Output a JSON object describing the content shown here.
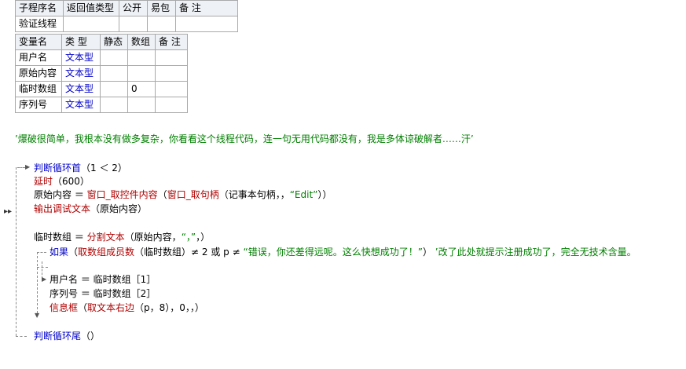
{
  "sub_table": {
    "headers": [
      "子程序名",
      "返回值类型",
      "公开",
      "易包",
      "备 注"
    ],
    "row": [
      "验证线程",
      "",
      "",
      "",
      ""
    ]
  },
  "var_table": {
    "headers": [
      "变量名",
      "类 型",
      "静态",
      "数组",
      "备 注"
    ],
    "rows": [
      [
        "用户名",
        "文本型",
        "",
        "",
        ""
      ],
      [
        "原始内容",
        "文本型",
        "",
        "",
        ""
      ],
      [
        "临时数组",
        "文本型",
        "",
        "0",
        ""
      ],
      [
        "序列号",
        "文本型",
        "",
        "",
        ""
      ]
    ]
  },
  "code": {
    "comment_line": "’爆破很简单，我根本没有做多复杂，你看看这个线程代码，连一句无用代码都没有，我是多体谅破解者……汗’",
    "loop_kw": "判断循环首",
    "loop_args": "（1 ＜ 2）",
    "delay_kw": "延时",
    "delay_args": "（600）",
    "l3_var": "原始内容 ＝",
    "l3_fn": "窗口_取控件内容",
    "l3_mid": "（",
    "l3_fn2": "窗口_取句柄",
    "l3_args": "（记事本句柄，，",
    "l3_str": "“Edit”",
    "l3_end": "））",
    "debug_kw": "输出调试文本",
    "debug_args": "（原始内容）",
    "l5_var": "临时数组 ＝",
    "l5_fn": "分割文本",
    "l5_args": "（原始内容，",
    "l5_str": "“，”",
    "l5_end": "，）",
    "if_kw": "如果",
    "if_open": "（",
    "if_fn": "取数组成员数",
    "if_cond": "（临时数组）≠ 2 或 p ≠",
    "if_str": "“错误，你还差得远呢。这么快想成功了！”",
    "if_close": "）",
    "if_comment": "’改了此处就提示注册成功了，完全无技术含量。",
    "l7": "用户名 ＝ 临时数组［1］",
    "l8": "序列号 ＝ 临时数组［2］",
    "msg_kw": "信息框",
    "msg_open": "（",
    "msg_fn": "取文本右边",
    "msg_args": "（p，8），0，，）",
    "loop_end_kw": "判断循环尾",
    "loop_end_args": "（）"
  }
}
